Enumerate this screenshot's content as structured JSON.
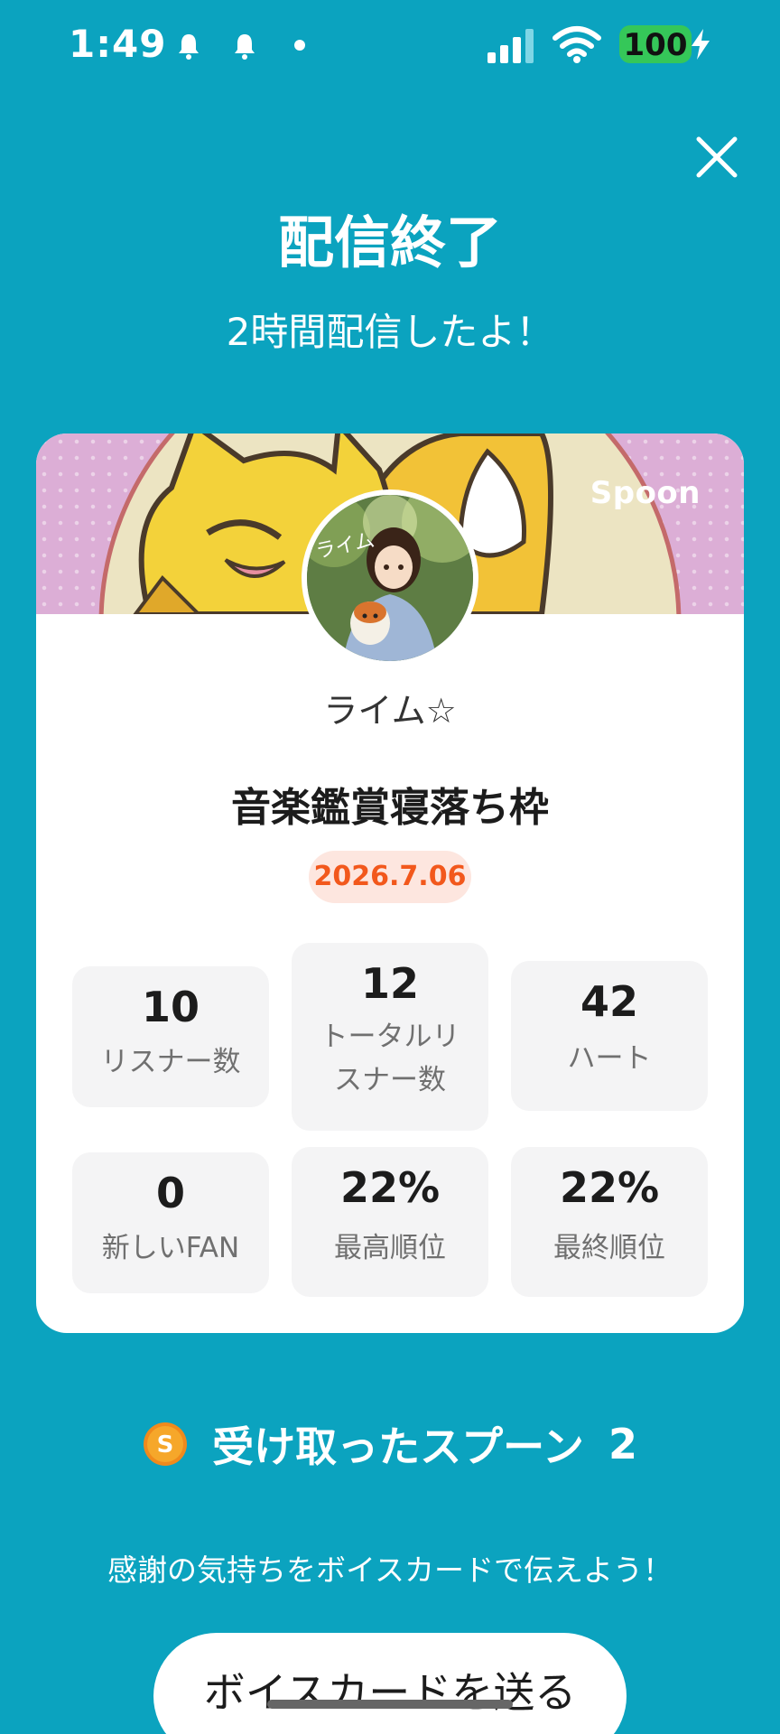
{
  "status_bar": {
    "time": "1:49",
    "battery": "100",
    "icons": [
      "bell-notification-icon",
      "bell-notification-icon",
      "dot-icon",
      "cellular-signal-icon",
      "wifi-icon",
      "battery-icon",
      "charging-bolt-icon"
    ],
    "battery_color": "#35c759"
  },
  "header": {
    "title": "配信終了",
    "subtitle": "2時間配信したよ！",
    "close_icon": "close-icon"
  },
  "card": {
    "brand": "Spoon",
    "host_name": "ライム☆",
    "live_title": "音楽鑑賞寝落ち枠",
    "date": "2026.7.06",
    "avatar_caption": "ライム",
    "stats": [
      {
        "value": "10",
        "label": "リスナー数"
      },
      {
        "value": "12",
        "label_line1": "トータルリ",
        "label_line2": "スナー数"
      },
      {
        "value": "42",
        "label": "ハート"
      },
      {
        "value": "0",
        "label": "新しいFAN"
      },
      {
        "value": "22%",
        "label": "最高順位"
      },
      {
        "value": "22%",
        "label": "最終順位"
      }
    ]
  },
  "spoons": {
    "icon": "spoon-coin-icon",
    "label": "受け取ったスプーン",
    "count": "2"
  },
  "thanks_text": "感謝の気持ちをボイスカードで伝えよう！",
  "send_button": "ボイスカードを送る",
  "colors": {
    "background": "#0ba3bf",
    "card": "#ffffff",
    "date_badge_bg": "#fde6df",
    "date_badge_text": "#f2581c",
    "stat_box": "#f4f4f5"
  }
}
